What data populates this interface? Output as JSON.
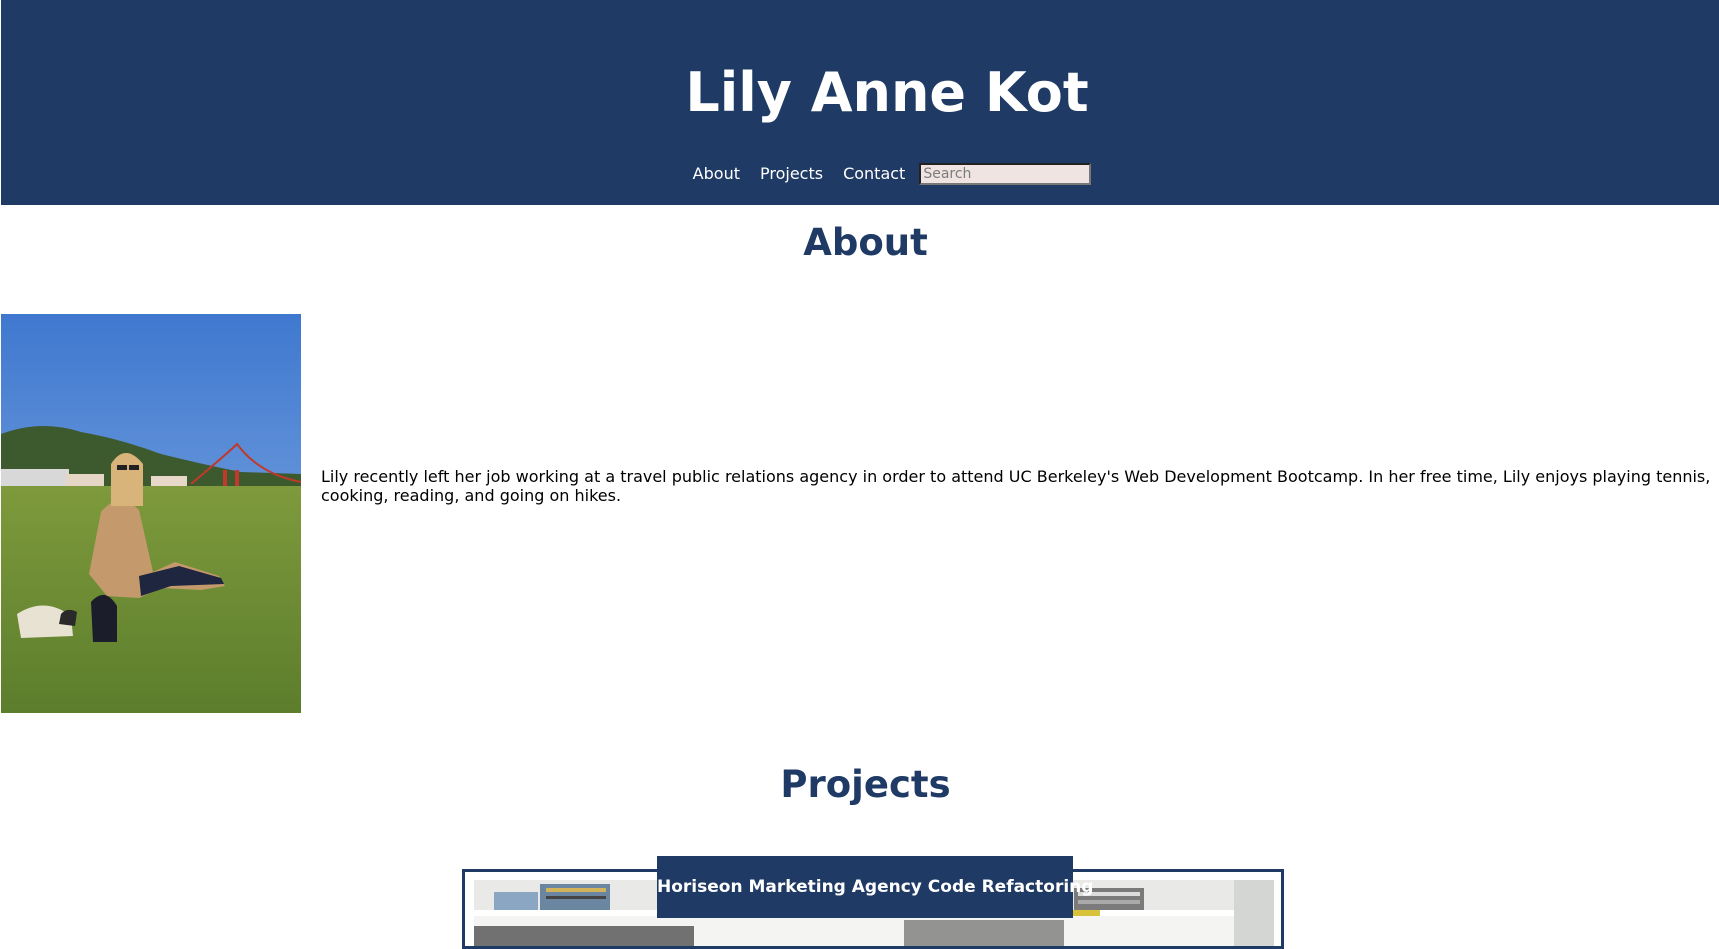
{
  "header": {
    "title": "Lily Anne Kot",
    "nav": [
      {
        "label": "About"
      },
      {
        "label": "Projects"
      },
      {
        "label": "Contact"
      }
    ],
    "search": {
      "placeholder": "Search",
      "value": ""
    }
  },
  "about": {
    "heading": "About",
    "photo_alt": "Lily sitting on the grass with the Golden Gate Bridge in the background",
    "text_line_1": "Lily recently left her job working at a travel public relations agency in order to attend UC Berkeley's Web Development Bootcamp. In her free time, Lily enjoys playing tennis,",
    "text_line_2": "cooking, reading, and going on hikes."
  },
  "projects": {
    "heading": "Projects",
    "items": [
      {
        "title": "Horiseon Marketing Agency Code Refactoring"
      }
    ]
  },
  "colors": {
    "brand_navy": "#1f3a64",
    "search_bg": "#efe4e1",
    "text": "#000000"
  }
}
